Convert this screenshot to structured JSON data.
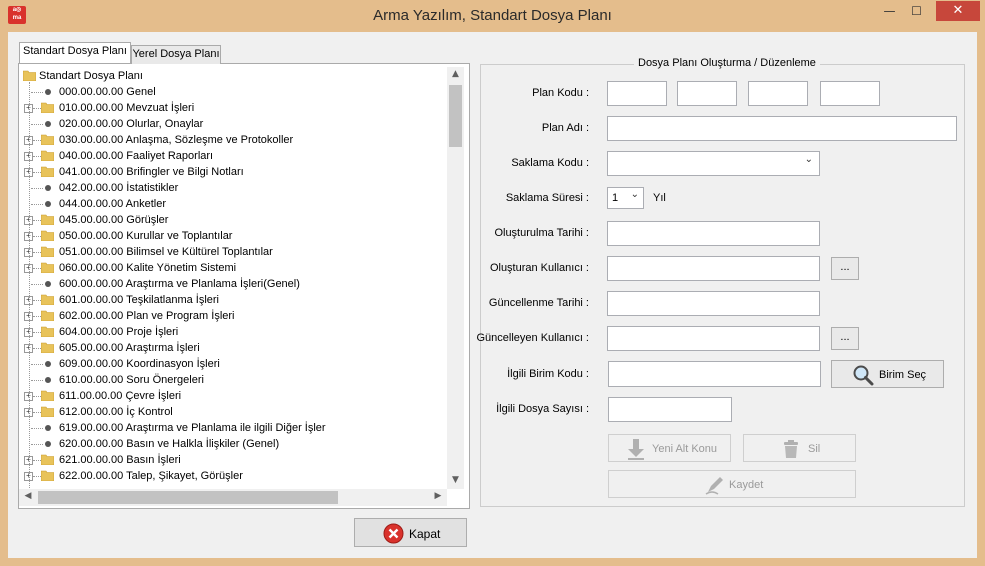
{
  "window": {
    "title": "Arma Yazılım, Standart Dosya Planı",
    "icon_text": "a◎ ma",
    "minimize": "—",
    "maximize": "☐",
    "close": "✕"
  },
  "tabs": [
    {
      "label": "Standart Dosya Planı",
      "active": true
    },
    {
      "label": "Yerel Dosya Planı",
      "active": false
    }
  ],
  "tree": {
    "root": "Standart Dosya Planı",
    "items": [
      {
        "label": "000.00.00.00 Genel",
        "folder": false
      },
      {
        "label": "010.00.00.00 Mevzuat İşleri",
        "folder": true
      },
      {
        "label": "020.00.00.00 Olurlar, Onaylar",
        "folder": false
      },
      {
        "label": "030.00.00.00 Anlaşma, Sözleşme ve Protokoller",
        "folder": true
      },
      {
        "label": "040.00.00.00 Faaliyet Raporları",
        "folder": true
      },
      {
        "label": "041.00.00.00 Brifingler ve Bilgi Notları",
        "folder": true
      },
      {
        "label": "042.00.00.00 İstatistikler",
        "folder": false
      },
      {
        "label": "044.00.00.00 Anketler",
        "folder": false
      },
      {
        "label": "045.00.00.00 Görüşler",
        "folder": true
      },
      {
        "label": "050.00.00.00 Kurullar ve Toplantılar",
        "folder": true
      },
      {
        "label": "051.00.00.00 Bilimsel ve Kültürel Toplantılar",
        "folder": true
      },
      {
        "label": "060.00.00.00 Kalite Yönetim Sistemi",
        "folder": true
      },
      {
        "label": "600.00.00.00 Araştırma ve Planlama İşleri(Genel)",
        "folder": false
      },
      {
        "label": "601.00.00.00 Teşkilatlanma İşleri",
        "folder": true
      },
      {
        "label": "602.00.00.00 Plan ve Program İşleri",
        "folder": true
      },
      {
        "label": "604.00.00.00 Proje İşleri",
        "folder": true
      },
      {
        "label": "605.00.00.00 Araştırma İşleri",
        "folder": true
      },
      {
        "label": "609.00.00.00 Koordinasyon İşleri",
        "folder": false
      },
      {
        "label": "610.00.00.00 Soru Önergeleri",
        "folder": false
      },
      {
        "label": "611.00.00.00 Çevre İşleri",
        "folder": true
      },
      {
        "label": "612.00.00.00 İç Kontrol",
        "folder": true
      },
      {
        "label": "619.00.00.00 Araştırma ve Planlama ile ilgili Diğer İşler",
        "folder": false
      },
      {
        "label": "620.00.00.00 Basın ve Halkla İlişkiler (Genel)",
        "folder": false
      },
      {
        "label": "621.00.00.00 Basın İşleri",
        "folder": true
      },
      {
        "label": "622.00.00.00 Talep, Şikayet, Görüşler",
        "folder": true
      }
    ]
  },
  "form": {
    "group_title": "Dosya Planı Oluşturma / Düzenleme",
    "plan_kodu_label": "Plan Kodu :",
    "plan_adi_label": "Plan Adı :",
    "saklama_kodu_label": "Saklama Kodu :",
    "saklama_suresi_label": "Saklama Süresi :",
    "saklama_suresi_value": "1",
    "saklama_suresi_unit": "Yıl",
    "olusturulma_tarihi_label": "Oluşturulma Tarihi :",
    "olusturan_kullanici_label": "Oluşturan Kullanıcı :",
    "guncellenme_tarihi_label": "Güncellenme Tarihi :",
    "guncelleyen_kullanici_label": "Güncelleyen Kullanıcı :",
    "ilgili_birim_kodu_label": "İlgili Birim Kodu :",
    "ilgili_dosya_sayisi_label": "İlgili Dosya Sayısı :",
    "browse_label": "...",
    "birim_sec_label": "Birim Seç",
    "yeni_alt_konu_label": "Yeni Alt Konu",
    "sil_label": "Sil",
    "kaydet_label": "Kaydet"
  },
  "footer": {
    "kapat_label": "Kapat"
  },
  "colors": {
    "frame": "#e4bd8c",
    "close_button": "#c7473b",
    "client_bg": "#f0f0f0",
    "folder": "#e8c35a",
    "kapat_icon": "#d9322c"
  }
}
